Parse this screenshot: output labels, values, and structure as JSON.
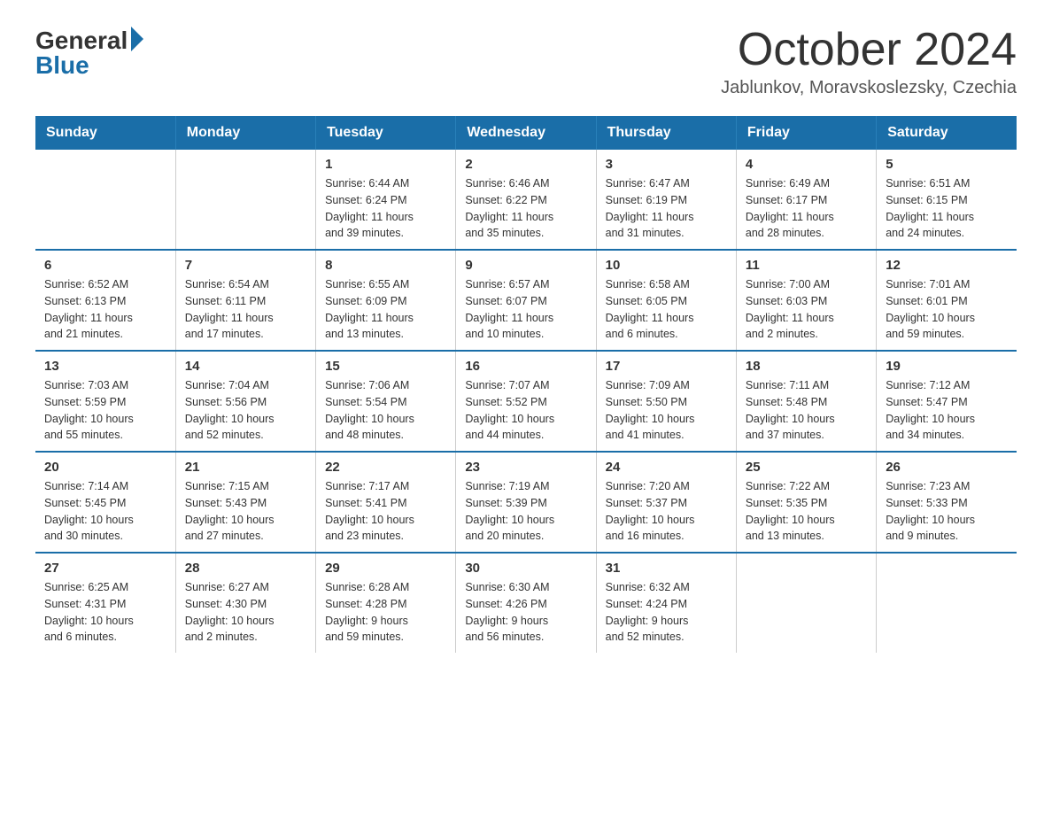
{
  "header": {
    "logo": {
      "general": "General",
      "blue": "Blue"
    },
    "title": "October 2024",
    "location": "Jablunkov, Moravskoslezsky, Czechia"
  },
  "weekdays": [
    "Sunday",
    "Monday",
    "Tuesday",
    "Wednesday",
    "Thursday",
    "Friday",
    "Saturday"
  ],
  "weeks": [
    [
      {
        "day": "",
        "info": ""
      },
      {
        "day": "",
        "info": ""
      },
      {
        "day": "1",
        "info": "Sunrise: 6:44 AM\nSunset: 6:24 PM\nDaylight: 11 hours\nand 39 minutes."
      },
      {
        "day": "2",
        "info": "Sunrise: 6:46 AM\nSunset: 6:22 PM\nDaylight: 11 hours\nand 35 minutes."
      },
      {
        "day": "3",
        "info": "Sunrise: 6:47 AM\nSunset: 6:19 PM\nDaylight: 11 hours\nand 31 minutes."
      },
      {
        "day": "4",
        "info": "Sunrise: 6:49 AM\nSunset: 6:17 PM\nDaylight: 11 hours\nand 28 minutes."
      },
      {
        "day": "5",
        "info": "Sunrise: 6:51 AM\nSunset: 6:15 PM\nDaylight: 11 hours\nand 24 minutes."
      }
    ],
    [
      {
        "day": "6",
        "info": "Sunrise: 6:52 AM\nSunset: 6:13 PM\nDaylight: 11 hours\nand 21 minutes."
      },
      {
        "day": "7",
        "info": "Sunrise: 6:54 AM\nSunset: 6:11 PM\nDaylight: 11 hours\nand 17 minutes."
      },
      {
        "day": "8",
        "info": "Sunrise: 6:55 AM\nSunset: 6:09 PM\nDaylight: 11 hours\nand 13 minutes."
      },
      {
        "day": "9",
        "info": "Sunrise: 6:57 AM\nSunset: 6:07 PM\nDaylight: 11 hours\nand 10 minutes."
      },
      {
        "day": "10",
        "info": "Sunrise: 6:58 AM\nSunset: 6:05 PM\nDaylight: 11 hours\nand 6 minutes."
      },
      {
        "day": "11",
        "info": "Sunrise: 7:00 AM\nSunset: 6:03 PM\nDaylight: 11 hours\nand 2 minutes."
      },
      {
        "day": "12",
        "info": "Sunrise: 7:01 AM\nSunset: 6:01 PM\nDaylight: 10 hours\nand 59 minutes."
      }
    ],
    [
      {
        "day": "13",
        "info": "Sunrise: 7:03 AM\nSunset: 5:59 PM\nDaylight: 10 hours\nand 55 minutes."
      },
      {
        "day": "14",
        "info": "Sunrise: 7:04 AM\nSunset: 5:56 PM\nDaylight: 10 hours\nand 52 minutes."
      },
      {
        "day": "15",
        "info": "Sunrise: 7:06 AM\nSunset: 5:54 PM\nDaylight: 10 hours\nand 48 minutes."
      },
      {
        "day": "16",
        "info": "Sunrise: 7:07 AM\nSunset: 5:52 PM\nDaylight: 10 hours\nand 44 minutes."
      },
      {
        "day": "17",
        "info": "Sunrise: 7:09 AM\nSunset: 5:50 PM\nDaylight: 10 hours\nand 41 minutes."
      },
      {
        "day": "18",
        "info": "Sunrise: 7:11 AM\nSunset: 5:48 PM\nDaylight: 10 hours\nand 37 minutes."
      },
      {
        "day": "19",
        "info": "Sunrise: 7:12 AM\nSunset: 5:47 PM\nDaylight: 10 hours\nand 34 minutes."
      }
    ],
    [
      {
        "day": "20",
        "info": "Sunrise: 7:14 AM\nSunset: 5:45 PM\nDaylight: 10 hours\nand 30 minutes."
      },
      {
        "day": "21",
        "info": "Sunrise: 7:15 AM\nSunset: 5:43 PM\nDaylight: 10 hours\nand 27 minutes."
      },
      {
        "day": "22",
        "info": "Sunrise: 7:17 AM\nSunset: 5:41 PM\nDaylight: 10 hours\nand 23 minutes."
      },
      {
        "day": "23",
        "info": "Sunrise: 7:19 AM\nSunset: 5:39 PM\nDaylight: 10 hours\nand 20 minutes."
      },
      {
        "day": "24",
        "info": "Sunrise: 7:20 AM\nSunset: 5:37 PM\nDaylight: 10 hours\nand 16 minutes."
      },
      {
        "day": "25",
        "info": "Sunrise: 7:22 AM\nSunset: 5:35 PM\nDaylight: 10 hours\nand 13 minutes."
      },
      {
        "day": "26",
        "info": "Sunrise: 7:23 AM\nSunset: 5:33 PM\nDaylight: 10 hours\nand 9 minutes."
      }
    ],
    [
      {
        "day": "27",
        "info": "Sunrise: 6:25 AM\nSunset: 4:31 PM\nDaylight: 10 hours\nand 6 minutes."
      },
      {
        "day": "28",
        "info": "Sunrise: 6:27 AM\nSunset: 4:30 PM\nDaylight: 10 hours\nand 2 minutes."
      },
      {
        "day": "29",
        "info": "Sunrise: 6:28 AM\nSunset: 4:28 PM\nDaylight: 9 hours\nand 59 minutes."
      },
      {
        "day": "30",
        "info": "Sunrise: 6:30 AM\nSunset: 4:26 PM\nDaylight: 9 hours\nand 56 minutes."
      },
      {
        "day": "31",
        "info": "Sunrise: 6:32 AM\nSunset: 4:24 PM\nDaylight: 9 hours\nand 52 minutes."
      },
      {
        "day": "",
        "info": ""
      },
      {
        "day": "",
        "info": ""
      }
    ]
  ]
}
